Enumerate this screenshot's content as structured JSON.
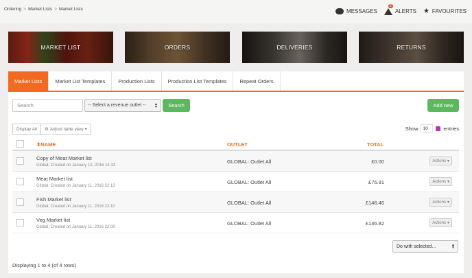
{
  "breadcrumb": [
    "Ordering",
    "Market Lists",
    "Market Lists"
  ],
  "breadcrumb_sep": ">",
  "topnav": {
    "messages": "MESSAGES",
    "alerts": "ALERTS",
    "alerts_count": "2",
    "favourites": "FAVOURITES"
  },
  "banners": [
    "MARKET LIST",
    "ORDERS",
    "DELIVERIES",
    "RETURNS"
  ],
  "tabs": [
    "Market Lists",
    "Market List Templates",
    "Production Lists",
    "Production List Templates",
    "Repeat Orders"
  ],
  "toolbar": {
    "search_placeholder": "Search",
    "outlet_select": "-- Select a revenue outlet --",
    "search_button": "Search",
    "add_new": "Add new",
    "display_all": "Display All",
    "adjust_view": "Adjust table view",
    "show_label": "Show",
    "show_value": "10",
    "entries_label": "entries"
  },
  "table": {
    "headers": {
      "name": "NAME",
      "outlet": "OUTLET",
      "total": "TOTAL"
    },
    "rows": [
      {
        "name": "Copy of Meat Market list",
        "sub": "Global, Created on January 12, 2016 14:33",
        "outlet": "GLOBAL: Outlet All",
        "total": "£0.00",
        "actions": "Actions"
      },
      {
        "name": "Meat Market list",
        "sub": "Global, Created on January 11, 2016 22:13",
        "outlet": "GLOBAL: Outlet All",
        "total": "£76.91",
        "actions": "Actions"
      },
      {
        "name": "Fish Market list",
        "sub": "Global, Created on January 11, 2016 22:10",
        "outlet": "GLOBAL: Outlet All",
        "total": "£146.46",
        "actions": "Actions"
      },
      {
        "name": "Veg Market list",
        "sub": "Global, Created on January 11, 2016 22:09",
        "outlet": "GLOBAL: Outlet All",
        "total": "£146.82",
        "actions": "Actions"
      }
    ]
  },
  "bulk_action": "Do with selected...",
  "footer": "Displaying 1 to 4 (of 4 rows)",
  "colors": {
    "accent": "#f26a21",
    "green": "#5cb85c"
  }
}
